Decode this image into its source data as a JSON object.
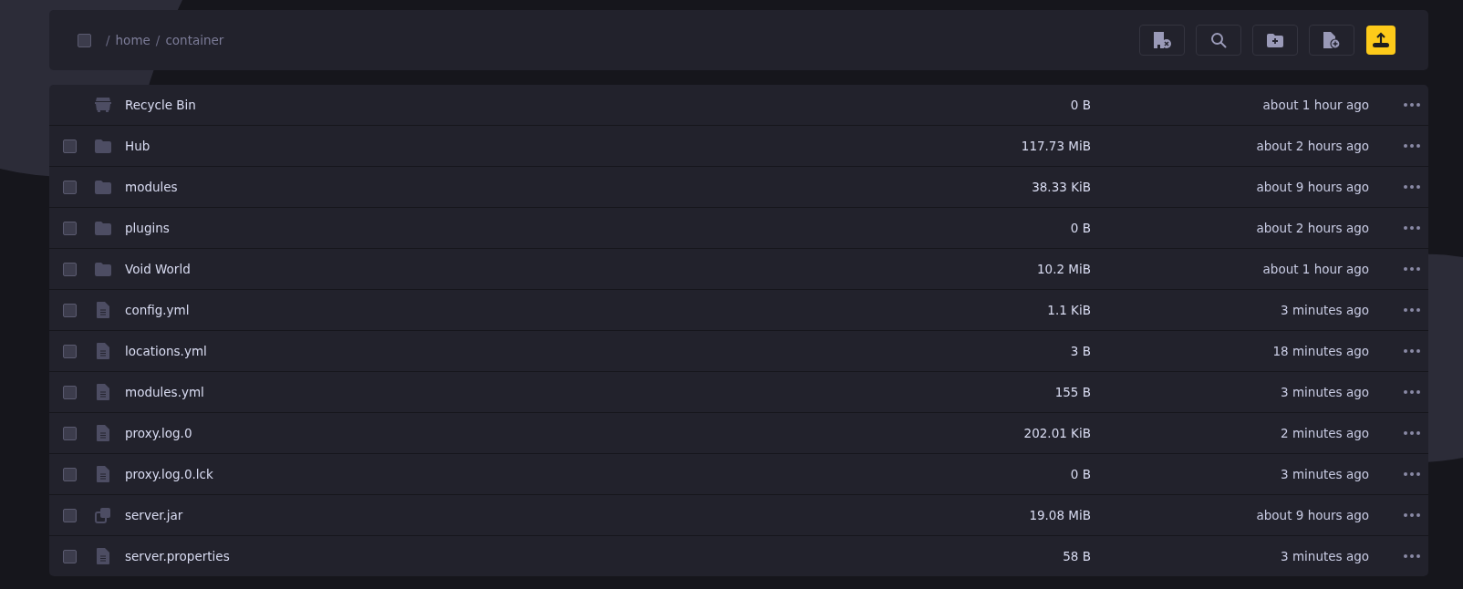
{
  "toolbar": {
    "select_all": {
      "checked": false
    },
    "breadcrumb": [
      {
        "separator": "/",
        "label": "home"
      },
      {
        "separator": "/",
        "label": "container"
      }
    ],
    "buttons": [
      {
        "kind": "building"
      },
      {
        "kind": "search"
      },
      {
        "kind": "new-folder"
      },
      {
        "kind": "new-file"
      },
      {
        "kind": "upload"
      }
    ]
  },
  "files": [
    {
      "kind": "recycle",
      "name": "Recycle Bin",
      "size": "0 B",
      "modified": "about 1 hour ago"
    },
    {
      "kind": "folder",
      "checked": false,
      "name": "Hub",
      "size": "117.73 MiB",
      "modified": "about 2 hours ago"
    },
    {
      "kind": "folder",
      "checked": false,
      "name": "modules",
      "size": "38.33 KiB",
      "modified": "about 9 hours ago"
    },
    {
      "kind": "folder",
      "checked": false,
      "name": "plugins",
      "size": "0 B",
      "modified": "about 2 hours ago"
    },
    {
      "kind": "folder",
      "checked": false,
      "name": "Void World",
      "size": "10.2 MiB",
      "modified": "about 1 hour ago"
    },
    {
      "kind": "file",
      "checked": false,
      "name": "config.yml",
      "size": "1.1 KiB",
      "modified": "3 minutes ago"
    },
    {
      "kind": "file",
      "checked": false,
      "name": "locations.yml",
      "size": "3 B",
      "modified": "18 minutes ago"
    },
    {
      "kind": "file",
      "checked": false,
      "name": "modules.yml",
      "size": "155 B",
      "modified": "3 minutes ago"
    },
    {
      "kind": "file",
      "checked": false,
      "name": "proxy.log.0",
      "size": "202.01 KiB",
      "modified": "2 minutes ago"
    },
    {
      "kind": "file",
      "checked": false,
      "name": "proxy.log.0.lck",
      "size": "0 B",
      "modified": "3 minutes ago"
    },
    {
      "kind": "jar",
      "checked": false,
      "name": "server.jar",
      "size": "19.08 MiB",
      "modified": "about 9 hours ago"
    },
    {
      "kind": "file",
      "checked": false,
      "name": "server.properties",
      "size": "58 B",
      "modified": "3 minutes ago"
    }
  ]
}
